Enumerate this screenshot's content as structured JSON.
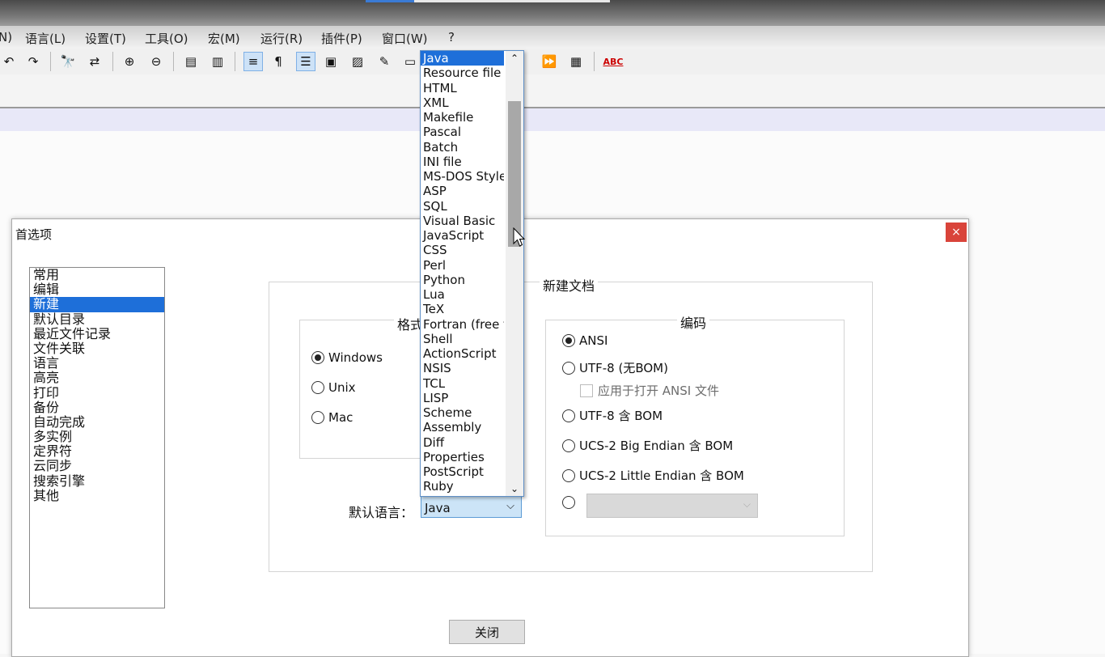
{
  "menu": [
    "N)",
    "语言(L)",
    "设置(T)",
    "工具(O)",
    "宏(M)",
    "运行(R)",
    "插件(P)",
    "窗口(W)",
    "?"
  ],
  "toolbar_icons": [
    "undo-icon",
    "redo-icon",
    "find-icon",
    "replace-icon",
    "zoom-in-icon",
    "zoom-out-icon",
    "sync-v-icon",
    "sync-h-icon",
    "wrap-icon",
    "show-all-chars-icon",
    "indent-guide-icon",
    "doc-map-icon",
    "function-list-icon",
    "folder-as-workspace-icon",
    "monitor-icon",
    "macro-play-icon",
    "macro-run-multiple-icon",
    "macro-save-icon",
    "spell-check-icon"
  ],
  "spellcheck_label": "ABC",
  "dialog": {
    "title": "首选项",
    "close_glyph": "×",
    "categories": [
      "常用",
      "编辑",
      "新建",
      "默认目录",
      "最近文件记录",
      "文件关联",
      "语言",
      "高亮",
      "打印",
      "备份",
      "自动完成",
      "多实例",
      "定界符",
      "云同步",
      "搜索引擎",
      "其他"
    ],
    "selected_category": "新建",
    "new_doc_title": "新建文档",
    "format_title": "格式",
    "format_options": [
      {
        "label": "Windows",
        "checked": true
      },
      {
        "label": "Unix",
        "checked": false
      },
      {
        "label": "Mac",
        "checked": false
      }
    ],
    "encoding_title": "编码",
    "encoding_options": [
      {
        "label": "ANSI",
        "checked": true
      },
      {
        "label": "UTF-8 (无BOM)",
        "checked": false
      },
      {
        "label": "UTF-8 含 BOM",
        "checked": false
      },
      {
        "label": "UCS-2 Big Endian 含 BOM",
        "checked": false
      },
      {
        "label": "UCS-2 Little Endian 含 BOM",
        "checked": false
      }
    ],
    "apply_ansi_label": "应用于打开 ANSI 文件",
    "default_lang_label": "默认语言：",
    "default_lang_value": "Java",
    "close_button": "关闭"
  },
  "language_dropdown": {
    "options": [
      "Java",
      "Resource file",
      "HTML",
      "XML",
      "Makefile",
      "Pascal",
      "Batch",
      "INI file",
      "MS-DOS Style",
      "ASP",
      "SQL",
      "Visual Basic",
      "JavaScript",
      "CSS",
      "Perl",
      "Python",
      "Lua",
      "TeX",
      "Fortran (free form)",
      "Shell",
      "ActionScript",
      "NSIS",
      "TCL",
      "LISP",
      "Scheme",
      "Assembly",
      "Diff",
      "Properties",
      "PostScript",
      "Ruby"
    ],
    "selected": "Java"
  },
  "colors": {
    "selection": "#1e6fd9",
    "close_red": "#d9443a"
  }
}
